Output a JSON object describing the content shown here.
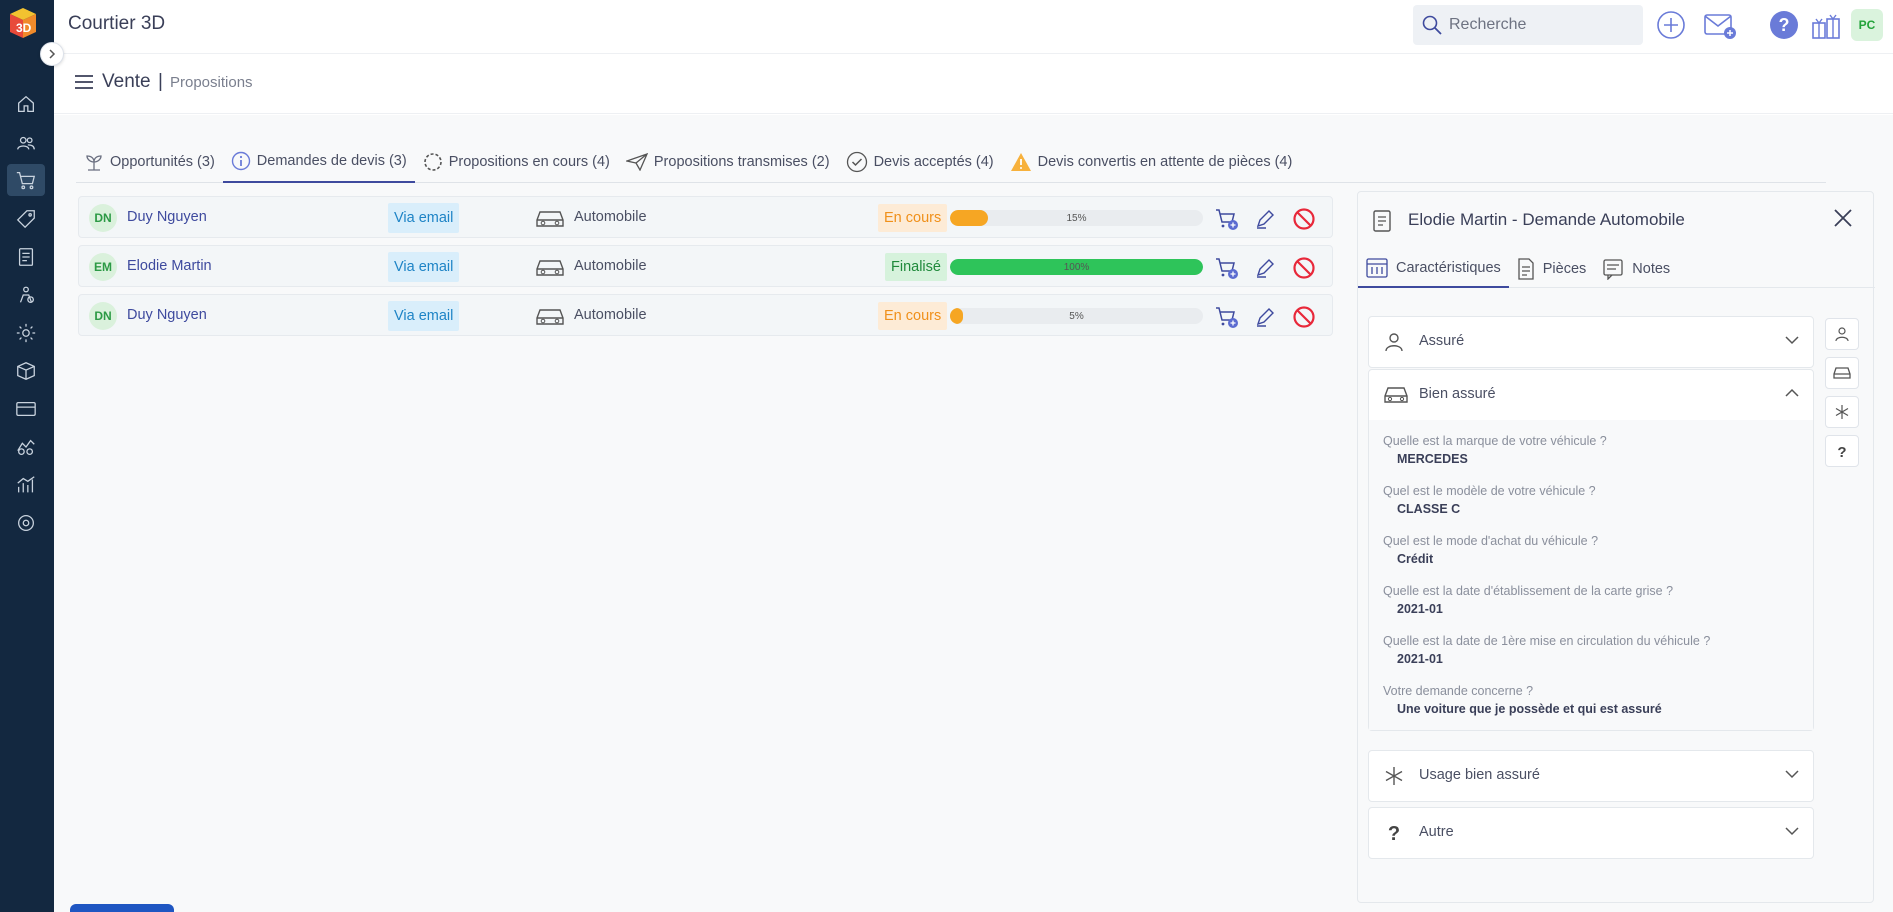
{
  "app": {
    "title": "Courtier 3D"
  },
  "search": {
    "placeholder": "Recherche"
  },
  "user": {
    "initials": "PC"
  },
  "breadcrumb": {
    "section": "Vente",
    "separator": "|",
    "page": "Propositions"
  },
  "tabs": [
    {
      "label": "Opportunités (3)",
      "icon": "plant-icon"
    },
    {
      "label": "Demandes de devis (3)",
      "icon": "info-icon"
    },
    {
      "label": "Propositions en cours (4)",
      "icon": "spinner-icon"
    },
    {
      "label": "Propositions transmises (2)",
      "icon": "paper-plane-icon"
    },
    {
      "label": "Devis acceptés (4)",
      "icon": "check-circle-icon"
    },
    {
      "label": "Devis convertis en attente de pièces (4)",
      "icon": "warning-icon"
    }
  ],
  "rows": [
    {
      "initials": "DN",
      "name": "Duy Nguyen",
      "channel": "Via email",
      "type": "Automobile",
      "status": "En cours",
      "progress": 15,
      "progress_label": "15%"
    },
    {
      "initials": "EM",
      "name": "Elodie Martin",
      "channel": "Via email",
      "type": "Automobile",
      "status": "Finalisé",
      "progress": 100,
      "progress_label": "100%"
    },
    {
      "initials": "DN",
      "name": "Duy Nguyen",
      "channel": "Via email",
      "type": "Automobile",
      "status": "En cours",
      "progress": 5,
      "progress_label": "5%"
    }
  ],
  "colors": {
    "progress_orange": "#f6a623",
    "progress_green": "#2ec45a",
    "accent": "#3e4a9e"
  },
  "panel": {
    "title": "Elodie Martin - Demande Automobile",
    "tabs": [
      "Caractéristiques",
      "Pièces",
      "Notes"
    ],
    "sections": {
      "assure": "Assuré",
      "bien": "Bien assuré",
      "usage": "Usage bien assuré",
      "autre": "Autre"
    },
    "questions": [
      {
        "q": "Quelle est la marque de votre véhicule ?",
        "a": "MERCEDES"
      },
      {
        "q": "Quel est le modèle de votre véhicule ?",
        "a": "CLASSE C"
      },
      {
        "q": "Quel est le mode d'achat du véhicule ?",
        "a": "Crédit"
      },
      {
        "q": "Quelle est la date d'établissement de la carte grise ?",
        "a": "2021-01"
      },
      {
        "q": "Quelle est la date de 1ère mise en circulation du véhicule ?",
        "a": "2021-01"
      },
      {
        "q": "Votre demande concerne ?",
        "a": "Une voiture que je possède et qui est assuré"
      }
    ]
  }
}
